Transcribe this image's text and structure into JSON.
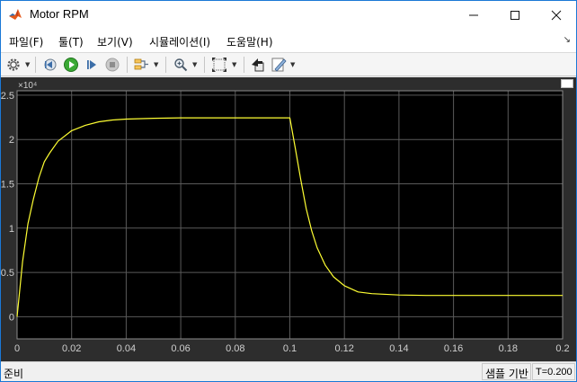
{
  "window": {
    "title": "Motor RPM",
    "minimize": "—",
    "maximize": "☐",
    "close": "✕"
  },
  "menu": {
    "items": [
      {
        "label": "파일(F)"
      },
      {
        "label": "툴(T)"
      },
      {
        "label": "보기(V)"
      },
      {
        "label": "시뮬레이션(I)"
      },
      {
        "label": "도움말(H)"
      }
    ],
    "overflow_icon": "↘"
  },
  "toolbar": {
    "icons": [
      "gear-icon",
      "step-back-icon",
      "run-icon",
      "step-forward-icon",
      "stop-icon",
      "signal-selector-icon",
      "zoom-icon",
      "fit-to-view-icon",
      "highlight-block-icon",
      "style-icon"
    ]
  },
  "colors": {
    "plot_background": "#000000",
    "frame_background": "#2d2d2d",
    "grid": "#5a5a5a",
    "axis_text": "#cfcfcf",
    "signal": "#ffff33",
    "title_bar": "#ffffff",
    "matlab_orange": "#e55a1c"
  },
  "chart_data": {
    "type": "line",
    "title": "",
    "xlabel": "",
    "ylabel": "",
    "exponent_label": "×10⁴",
    "xlim": [
      0,
      0.2
    ],
    "ylim": [
      -0.25,
      2.55
    ],
    "xticks": [
      0,
      0.02,
      0.04,
      0.06,
      0.08,
      0.1,
      0.12,
      0.14,
      0.16,
      0.18,
      0.2
    ],
    "xtick_labels": [
      "0",
      "0.02",
      "0.04",
      "0.06",
      "0.08",
      "0.1",
      "0.12",
      "0.14",
      "0.16",
      "0.18",
      "0.2"
    ],
    "yticks": [
      0,
      0.5,
      1,
      1.5,
      2,
      2.5
    ],
    "ytick_labels": [
      "0",
      "0.5",
      "1",
      "1.5",
      "2",
      "2.5"
    ],
    "grid": true,
    "series": [
      {
        "x": [
          0,
          0.002,
          0.004,
          0.006,
          0.008,
          0.01,
          0.012,
          0.015,
          0.02,
          0.025,
          0.03,
          0.035,
          0.04,
          0.05,
          0.06,
          0.07,
          0.08,
          0.09,
          0.1,
          0.102,
          0.104,
          0.106,
          0.108,
          0.11,
          0.113,
          0.116,
          0.12,
          0.125,
          0.13,
          0.14,
          0.15,
          0.16,
          0.18,
          0.2
        ],
        "y": [
          0,
          0.62,
          1.05,
          1.33,
          1.57,
          1.75,
          1.85,
          1.98,
          2.1,
          2.16,
          2.2,
          2.22,
          2.23,
          2.24,
          2.245,
          2.245,
          2.245,
          2.245,
          2.245,
          1.9,
          1.55,
          1.22,
          0.97,
          0.78,
          0.58,
          0.45,
          0.35,
          0.28,
          0.26,
          0.245,
          0.24,
          0.24,
          0.24,
          0.24
        ]
      }
    ]
  },
  "status": {
    "ready": "준비",
    "mode": "샘플 기반",
    "time": "T=0.200"
  }
}
